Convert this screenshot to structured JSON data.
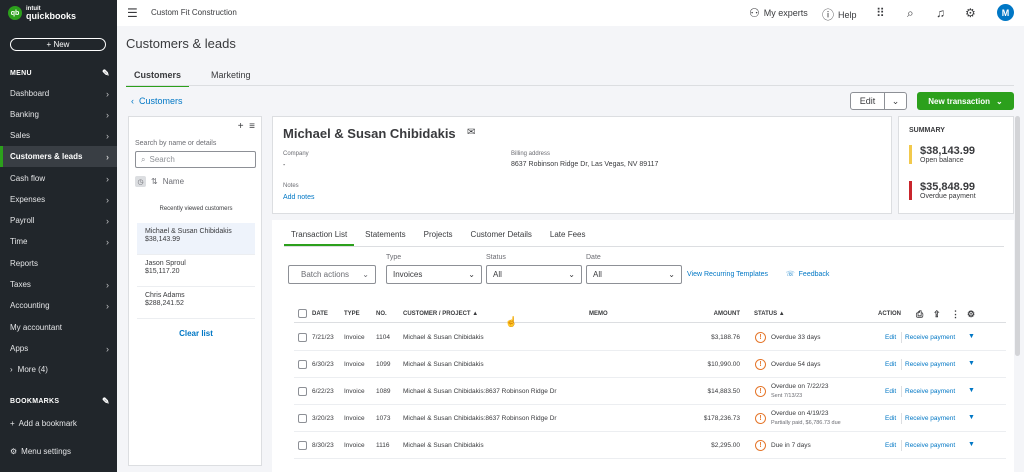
{
  "brand": {
    "top": "intuit",
    "bottom": "quickbooks",
    "accent": "#2ca01c"
  },
  "sidebar": {
    "new_label": "New",
    "menu_header": "MENU",
    "items": [
      {
        "label": "Dashboard"
      },
      {
        "label": "Banking"
      },
      {
        "label": "Sales"
      },
      {
        "label": "Customers & leads",
        "active": true
      },
      {
        "label": "Cash flow"
      },
      {
        "label": "Expenses"
      },
      {
        "label": "Payroll"
      },
      {
        "label": "Time"
      },
      {
        "label": "Reports"
      },
      {
        "label": "Taxes"
      },
      {
        "label": "Accounting"
      },
      {
        "label": "My accountant"
      },
      {
        "label": "Apps"
      },
      {
        "label": "More (4)"
      }
    ],
    "bookmarks_header": "BOOKMARKS",
    "add_bookmark": "Add a bookmark",
    "menu_settings": "Menu settings"
  },
  "topbar": {
    "company": "Custom Fit Construction",
    "my_experts": "My experts",
    "help": "Help",
    "avatar_initial": "M"
  },
  "page": {
    "title": "Customers & leads",
    "tabs": [
      "Customers",
      "Marketing"
    ],
    "back_link": "Customers",
    "edit_label": "Edit",
    "new_transaction_label": "New transaction"
  },
  "customer_list": {
    "search_label": "Search by name or details",
    "search_placeholder": "Search",
    "sort_label": "Name",
    "recent_label": "Recently viewed customers",
    "customers": [
      {
        "name": "Michael & Susan Chibidakis",
        "amount": "$38,143.99"
      },
      {
        "name": "Jason Sproul",
        "amount": "$15,117.20"
      },
      {
        "name": "Chris Adams",
        "amount": "$288,241.52"
      }
    ],
    "clear_list": "Clear list"
  },
  "customer": {
    "name": "Michael & Susan Chibidakis",
    "company_label": "Company",
    "company_value": "-",
    "billing_label": "Billing address",
    "billing_value": "8637 Robinson Ridge Dr, Las Vegas, NV 89117",
    "notes_label": "Notes",
    "add_notes": "Add notes"
  },
  "summary": {
    "header": "SUMMARY",
    "open_balance": "$38,143.99",
    "open_balance_label": "Open balance",
    "open_color": "#f2c94c",
    "overdue": "$35,848.99",
    "overdue_label": "Overdue payment",
    "overdue_color": "#c9252c"
  },
  "transactions": {
    "tabs": [
      "Transaction List",
      "Statements",
      "Projects",
      "Customer Details",
      "Late Fees"
    ],
    "batch_actions": "Batch actions",
    "type_label": "Type",
    "type_value": "Invoices",
    "status_label": "Status",
    "status_value": "All",
    "date_label": "Date",
    "date_value": "All",
    "recurring_link": "View Recurring Templates",
    "feedback": "Feedback",
    "columns": {
      "date": "DATE",
      "type": "TYPE",
      "no": "NO.",
      "customer": "CUSTOMER / PROJECT ▲",
      "memo": "MEMO",
      "amount": "AMOUNT",
      "status": "STATUS ▲",
      "action": "ACTION"
    },
    "rows": [
      {
        "date": "7/21/23",
        "type": "Invoice",
        "no": "1104",
        "customer": "Michael & Susan Chibidakis",
        "amount": "$3,188.76",
        "status": "Overdue 33 days",
        "status2": "",
        "edit": "Edit",
        "action": "Receive payment"
      },
      {
        "date": "6/30/23",
        "type": "Invoice",
        "no": "1099",
        "customer": "Michael & Susan Chibidakis",
        "amount": "$10,990.00",
        "status": "Overdue 54 days",
        "status2": "",
        "edit": "Edit",
        "action": "Receive payment"
      },
      {
        "date": "6/22/23",
        "type": "Invoice",
        "no": "1089",
        "customer": "Michael & Susan Chibidakis:8637 Robinson Ridge Dr",
        "amount": "$14,883.50",
        "status": "Overdue on 7/22/23",
        "status2": "Sent 7/13/23",
        "edit": "Edit",
        "action": "Receive payment"
      },
      {
        "date": "3/20/23",
        "type": "Invoice",
        "no": "1073",
        "customer": "Michael & Susan Chibidakis:8637 Robinson Ridge Dr",
        "amount": "$178,236.73",
        "status": "Overdue on 4/19/23",
        "status2": "Partially paid, $6,786.73 due",
        "edit": "Edit",
        "action": "Receive payment"
      },
      {
        "date": "8/30/23",
        "type": "Invoice",
        "no": "1116",
        "customer": "Michael & Susan Chibidakis",
        "amount": "$2,295.00",
        "status": "Due in 7 days",
        "status2": "",
        "edit": "Edit",
        "action": "Receive payment"
      }
    ]
  }
}
